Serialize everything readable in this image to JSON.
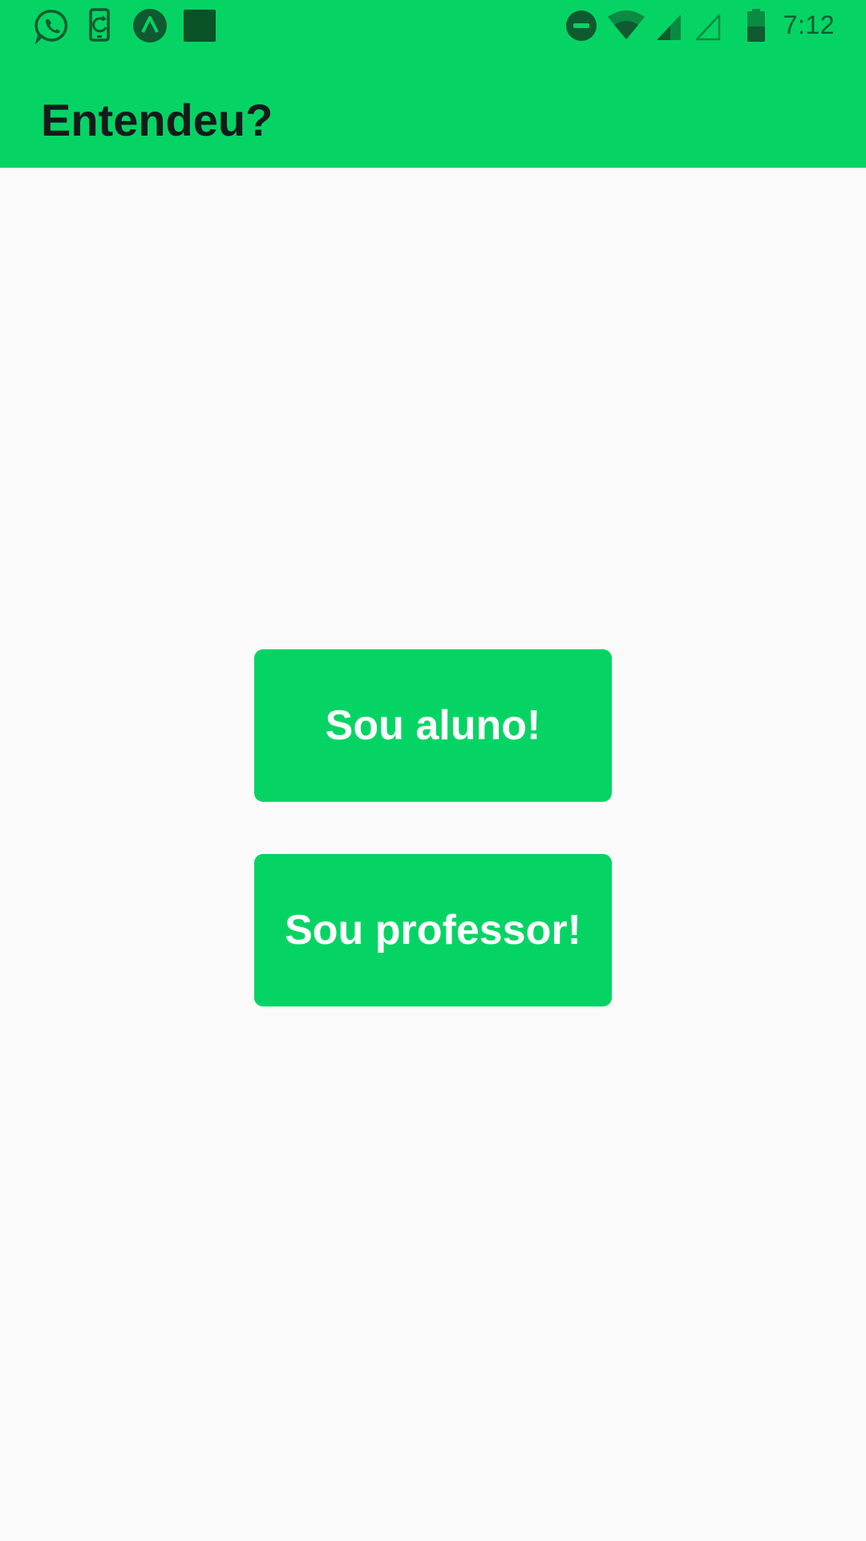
{
  "status_bar": {
    "time": "7:12",
    "left_icons": [
      "whatsapp-icon",
      "screen-rotation-icon",
      "expo-icon",
      "square-app-icon"
    ],
    "right_icons": [
      "do-not-disturb-icon",
      "wifi-icon",
      "signal-icon",
      "signal-empty-icon",
      "battery-icon"
    ]
  },
  "app_bar": {
    "title": "Entendeu?"
  },
  "main": {
    "student_button_label": "Sou aluno!",
    "teacher_button_label": "Sou professor!"
  },
  "colors": {
    "primary": "#05d464",
    "background": "#fafafa",
    "title_text": "#141a1c",
    "button_text": "#ffffff",
    "status_icons": "#0f5a30"
  }
}
